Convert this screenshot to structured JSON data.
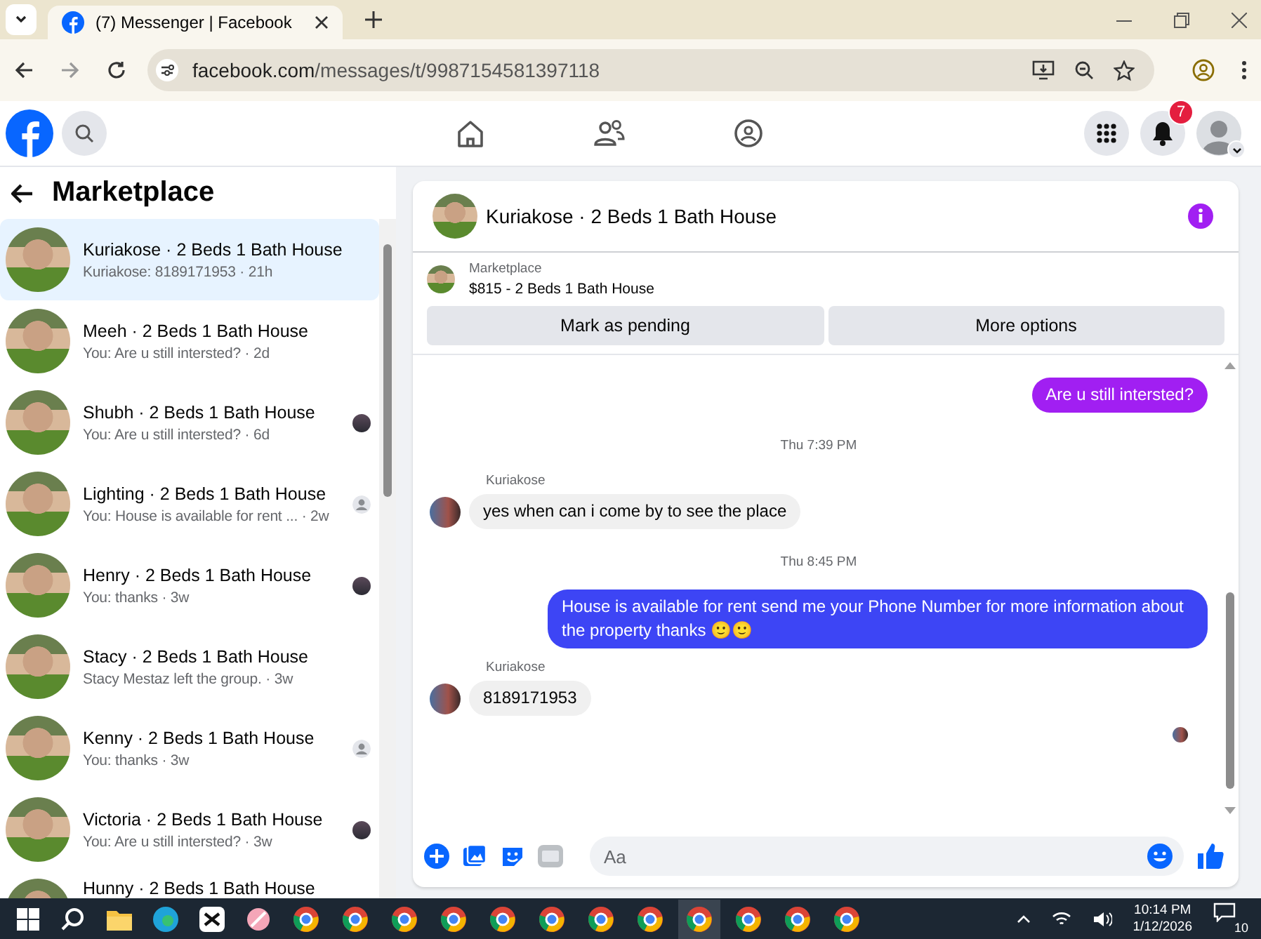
{
  "browser": {
    "tab_title": "(7) Messenger | Facebook",
    "url_host": "facebook.com",
    "url_path": "/messages/t/9987154581397118"
  },
  "header": {
    "notifications_badge": "7"
  },
  "sidebar": {
    "title": "Marketplace",
    "conversations": [
      {
        "kind": "plain",
        "name": "Kuriakose · 2 Beds 1 Bath House",
        "preview": "Kuriakose: 8189171953 · 21h",
        "selected": true
      },
      {
        "kind": "plain",
        "name": "Meeh · 2 Beds 1 Bath House",
        "preview": "You: Are u still intersted? · 2d",
        "selected": false
      },
      {
        "kind": "seen_photo",
        "name": "Shubh · 2 Beds 1 Bath House",
        "preview": "You: Are u still intersted? · 6d",
        "selected": false
      },
      {
        "kind": "seen_default",
        "name": "Lighting · 2 Beds 1 Bath House",
        "preview": "You: House is available for rent ... · 2w",
        "selected": false
      },
      {
        "kind": "seen_photo",
        "name": "Henry · 2 Beds 1 Bath House",
        "preview": "You: thanks · 3w",
        "selected": false
      },
      {
        "kind": "plain",
        "name": "Stacy · 2 Beds 1 Bath House",
        "preview": "Stacy Mestaz left the group. · 3w",
        "selected": false
      },
      {
        "kind": "seen_default",
        "name": "Kenny · 2 Beds 1 Bath House",
        "preview": "You: thanks · 3w",
        "selected": false
      },
      {
        "kind": "seen_photo",
        "name": "Victoria · 2 Beds 1 Bath House",
        "preview": "You: Are u still intersted? · 3w",
        "selected": false
      },
      {
        "kind": "plain",
        "name": "Hunny · 2 Beds 1 Bath House",
        "selected": false
      }
    ]
  },
  "chat": {
    "title": "Kuriakose · 2 Beds 1 Bath House",
    "listing_label": "Marketplace",
    "listing": "$815 - 2 Beds 1 Bath House",
    "actions": [
      "Mark as pending",
      "More options"
    ],
    "messages": [
      {
        "kind": "outgoing",
        "text": "Are u still intersted?",
        "color": "#a11ff2"
      },
      {
        "kind": "timestamp",
        "text": "Thu 7:39 PM"
      },
      {
        "kind": "incoming",
        "sender": "Kuriakose",
        "text": "yes when can i come by to see the place"
      },
      {
        "kind": "timestamp",
        "text": "Thu 8:45 PM"
      },
      {
        "kind": "outgoing",
        "text": "House is available for rent send me your Phone Number for more information about the property thanks 🙂🙂",
        "color": "#3d45f5"
      },
      {
        "kind": "incoming",
        "sender": "Kuriakose",
        "text": "8189171953"
      }
    ],
    "composer": {
      "placeholder": "Aa"
    }
  },
  "taskbar": {
    "time": "10:14 PM",
    "date": "1/12/2026",
    "notifications": "10"
  }
}
